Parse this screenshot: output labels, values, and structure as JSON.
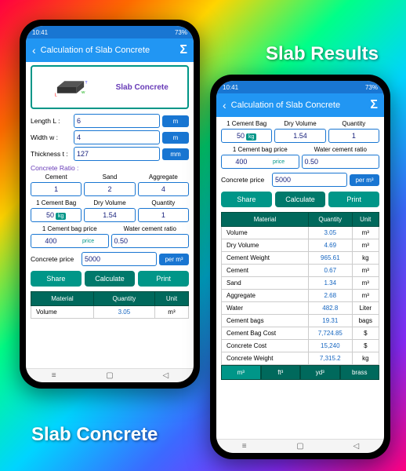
{
  "headings": {
    "results": "Slab Results",
    "concrete": "Slab Concrete"
  },
  "status": {
    "time": "10:41",
    "battery": "73%"
  },
  "appbar": {
    "title": "Calculation of Slab Concrete"
  },
  "diagram": {
    "label": "Slab Concrete"
  },
  "inputs": {
    "length": {
      "label": "Length L :",
      "value": "6",
      "unit": "m"
    },
    "width": {
      "label": "Width w :",
      "value": "4",
      "unit": "m"
    },
    "thickness": {
      "label": "Thickness t :",
      "value": "127",
      "unit": "mm"
    }
  },
  "ratio": {
    "label": "Concrete Ratio :",
    "cols": [
      {
        "h": "Cement",
        "v": "1"
      },
      {
        "h": "Sand",
        "v": "2"
      },
      {
        "h": "Aggregate",
        "v": "4"
      }
    ]
  },
  "bag": {
    "cols": [
      {
        "h": "1 Cement Bag",
        "v": "50",
        "u": "kg"
      },
      {
        "h": "Dry Volume",
        "v": "1.54"
      },
      {
        "h": "Quantity",
        "v": "1"
      }
    ]
  },
  "price": {
    "cols": [
      {
        "h": "1 Cement bag price",
        "v": "400",
        "u": "price"
      },
      {
        "h": "Water cement ratio",
        "v": "0.50"
      }
    ]
  },
  "concrete_price": {
    "label": "Concrete price",
    "value": "5000",
    "unit": "per m³"
  },
  "buttons": {
    "share": "Share",
    "calc": "Calculate",
    "print": "Print"
  },
  "table": {
    "headers": [
      "Material",
      "Quantity",
      "Unit"
    ],
    "rows": [
      [
        "Volume",
        "3.05",
        "m³"
      ],
      [
        "Dry Volume",
        "4.69",
        "m³"
      ],
      [
        "Cement Weight",
        "965.61",
        "kg"
      ],
      [
        "Cement",
        "0.67",
        "m³"
      ],
      [
        "Sand",
        "1.34",
        "m³"
      ],
      [
        "Aggregate",
        "2.68",
        "m³"
      ],
      [
        "Water",
        "482.8",
        "Liter"
      ],
      [
        "Cement bags",
        "19.31",
        "bags"
      ],
      [
        "Cement Bag Cost",
        "7,724.85",
        "$"
      ],
      [
        "Concrete Cost",
        "15,240",
        "$"
      ],
      [
        "Concrete Weight",
        "7,315.2",
        "kg"
      ]
    ]
  },
  "units": [
    "m³",
    "ft³",
    "yd³",
    "brass"
  ]
}
